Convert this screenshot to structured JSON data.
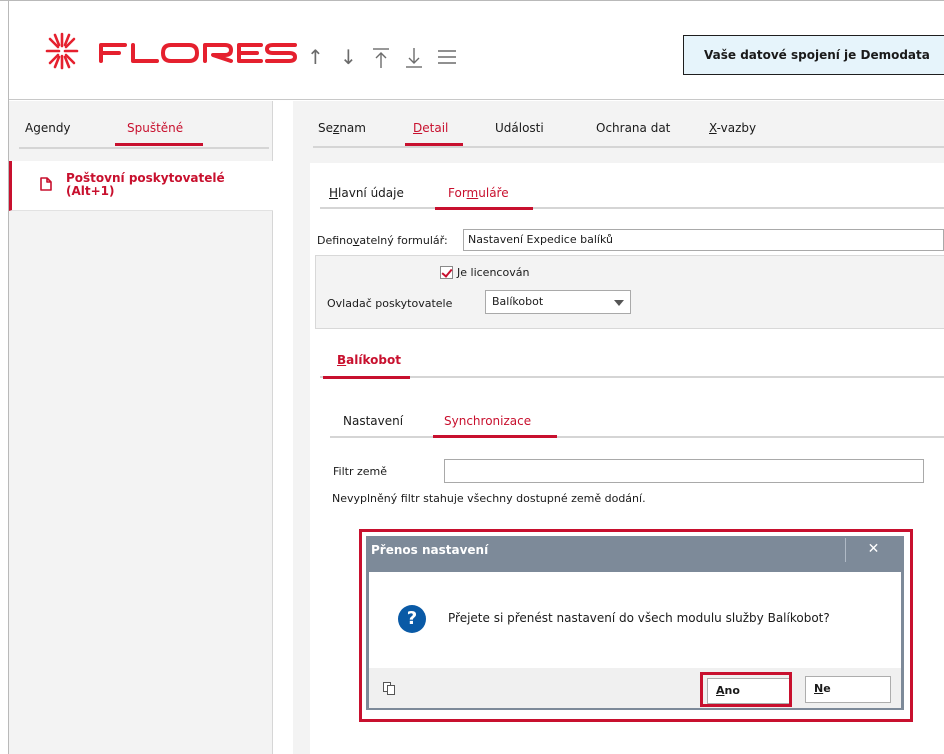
{
  "header": {
    "brand": "FLORES",
    "nav_icons": [
      "arrow-up-icon",
      "arrow-down-icon",
      "arrow-to-top-icon",
      "arrow-to-bottom-icon",
      "menu-icon"
    ],
    "info_text": "Vaše datové spojení je Demodata"
  },
  "left_panel": {
    "tabs": [
      {
        "label": "Agendy",
        "active": false
      },
      {
        "label": "Spuštěné",
        "active": true
      }
    ],
    "running_item": "Poštovní poskytovatelé\n(Alt+1)"
  },
  "main_tabs": [
    {
      "prefix": "Se",
      "accel": "z",
      "suffix": "nam",
      "active": false
    },
    {
      "prefix": "",
      "accel": "D",
      "suffix": "etail",
      "active": true
    },
    {
      "prefix": "Události",
      "accel": "",
      "suffix": "",
      "active": false
    },
    {
      "prefix": "Ochrana dat",
      "accel": "",
      "suffix": "",
      "active": false
    },
    {
      "prefix": "",
      "accel": "X",
      "suffix": "-vazby",
      "active": false
    }
  ],
  "sub_tabs": [
    {
      "prefix": "",
      "accel": "H",
      "suffix": "lavní údaje",
      "active": false
    },
    {
      "prefix": "For",
      "accel": "m",
      "suffix": "uláře",
      "active": true
    }
  ],
  "form": {
    "def_label_prefix": "Defino",
    "def_label_accel": "v",
    "def_label_suffix": "atelný formulář:",
    "def_value": "Nastavení Expedice balíků",
    "checkbox_accel": "J",
    "checkbox_label_rest": "e licencován",
    "checkbox_checked": true,
    "driver_label": "Ovladač poskytovatele",
    "driver_value": "Balíkobot"
  },
  "section_tab": {
    "prefix": "",
    "accel": "B",
    "suffix": "alíkobot"
  },
  "inner_tabs": [
    {
      "label": "Nastavení",
      "active": false
    },
    {
      "label": "Synchronizace",
      "active": true
    }
  ],
  "filter": {
    "label": "Filtr země",
    "value": "",
    "hint": "Nevyplněný filtr stahuje všechny dostupné země dodání."
  },
  "dialog": {
    "title": "Přenos nastavení",
    "close": "✕",
    "message": "Přejete si přenést nastavení do všech modulu služby Balíkobot?",
    "question_glyph": "?",
    "yes_accel": "A",
    "yes_rest": "no",
    "no_accel": "N",
    "no_rest": "e"
  },
  "colors": {
    "accent": "#c8102e",
    "info_bg": "#e6f4fb",
    "dialog_title_bg": "#7d8a99",
    "question_icon": "#0a5aa6"
  }
}
